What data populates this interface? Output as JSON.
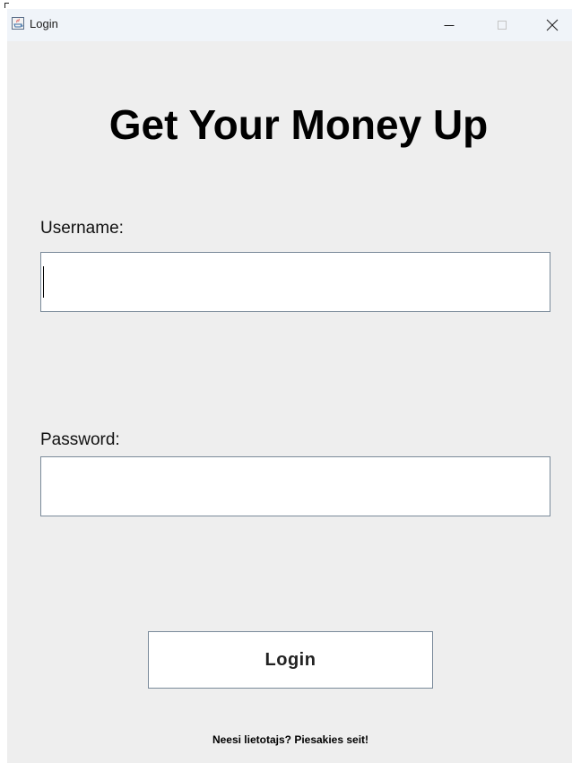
{
  "window": {
    "title": "Login",
    "icon": "java-icon",
    "controls": {
      "minimize_icon": "minimize-icon",
      "maximize_icon": "maximize-icon",
      "close_icon": "close-icon"
    }
  },
  "form": {
    "heading": "Get Your Money Up",
    "username_label": "Username:",
    "username_value": "",
    "password_label": "Password:",
    "password_value": "",
    "login_button": "Login",
    "register_link": "Neesi lietotajs? Piesakies seit!"
  },
  "colors": {
    "background": "#eeeeee",
    "titlebar": "#f0f4f9",
    "field_border": "#7a8a9a",
    "text": "#000000"
  }
}
